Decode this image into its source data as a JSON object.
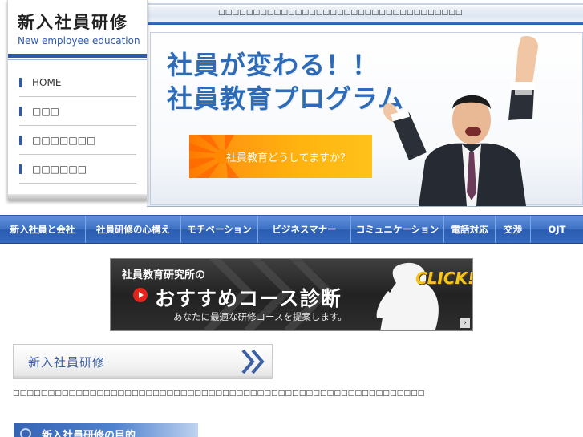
{
  "header": {
    "tagline": "□□□□□□□□□□□□□□□□□□□□□□□□□□□□□□□□□□□"
  },
  "logo": {
    "title": "新入社員研修",
    "subtitle": "New employee education"
  },
  "side_nav": {
    "items": [
      {
        "label": "HOME"
      },
      {
        "label": "□□□"
      },
      {
        "label": "□□□□□□□"
      },
      {
        "label": "□□□□□□"
      }
    ]
  },
  "hero": {
    "title_line1": "社員が変わる！！",
    "title_line2": "社員教育プログラム",
    "cta_label": "社員教育どうしてますか？"
  },
  "main_nav": {
    "items": [
      {
        "label": "新入社員と会社"
      },
      {
        "label": "社員研修の心構え"
      },
      {
        "label": "モチベーション"
      },
      {
        "label": "ビジネスマナー"
      },
      {
        "label": "コミュニケーション"
      },
      {
        "label": "電話対応"
      },
      {
        "label": "交渉"
      },
      {
        "label": "OJT"
      }
    ]
  },
  "banner": {
    "top_text": "社員教育研究所の",
    "main_text": "おすすめコース診断",
    "description": "あなたに最適な研修コースを提案します。",
    "click_text": "CLICK!",
    "arrow": "›"
  },
  "section": {
    "heading": "新入社員研修",
    "body_text": "□□□□□□□□□□□□□□□□□□□□□□□□□□□□□□□□□□□□□□□□□□□□□□□□□□□□□□□□□□□",
    "sub_heading": "新入社員研修の目的"
  },
  "colors": {
    "brand_blue": "#2f5aa8",
    "hero_text": "#2d6bb6",
    "cta_orange": "#ff9a10",
    "nav_blue": "#3f72c4",
    "click_yellow": "#f6c51c"
  }
}
